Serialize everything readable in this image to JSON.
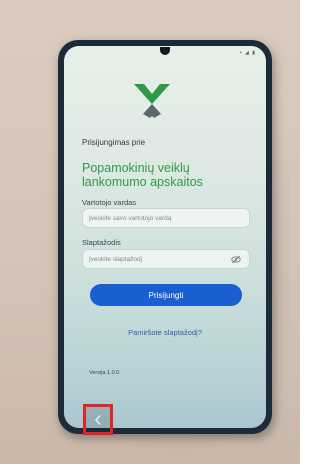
{
  "login": {
    "heading_small": "Prisijungimas prie",
    "heading_big": "Popamokinių veiklų lankomumo apskaitos",
    "username_label": "Vartotojo vardas",
    "username_placeholder": "Įveskite savo vartotojo vardą",
    "password_label": "Slaptažodis",
    "password_placeholder": "Įveskite slaptažodį",
    "login_button": "Prisijungti",
    "forgot_link": "Pamiršote slaptažodį?",
    "version": "Versija 1.0.0"
  },
  "icons": {
    "logo": "app-logo-icon",
    "password_toggle": "eye-slash-icon",
    "back": "chevron-left-icon"
  },
  "colors": {
    "heading_accent": "#2f9a46",
    "button": "#1a5fd1",
    "link": "#2a5fb0",
    "highlight": "#e0242a"
  }
}
